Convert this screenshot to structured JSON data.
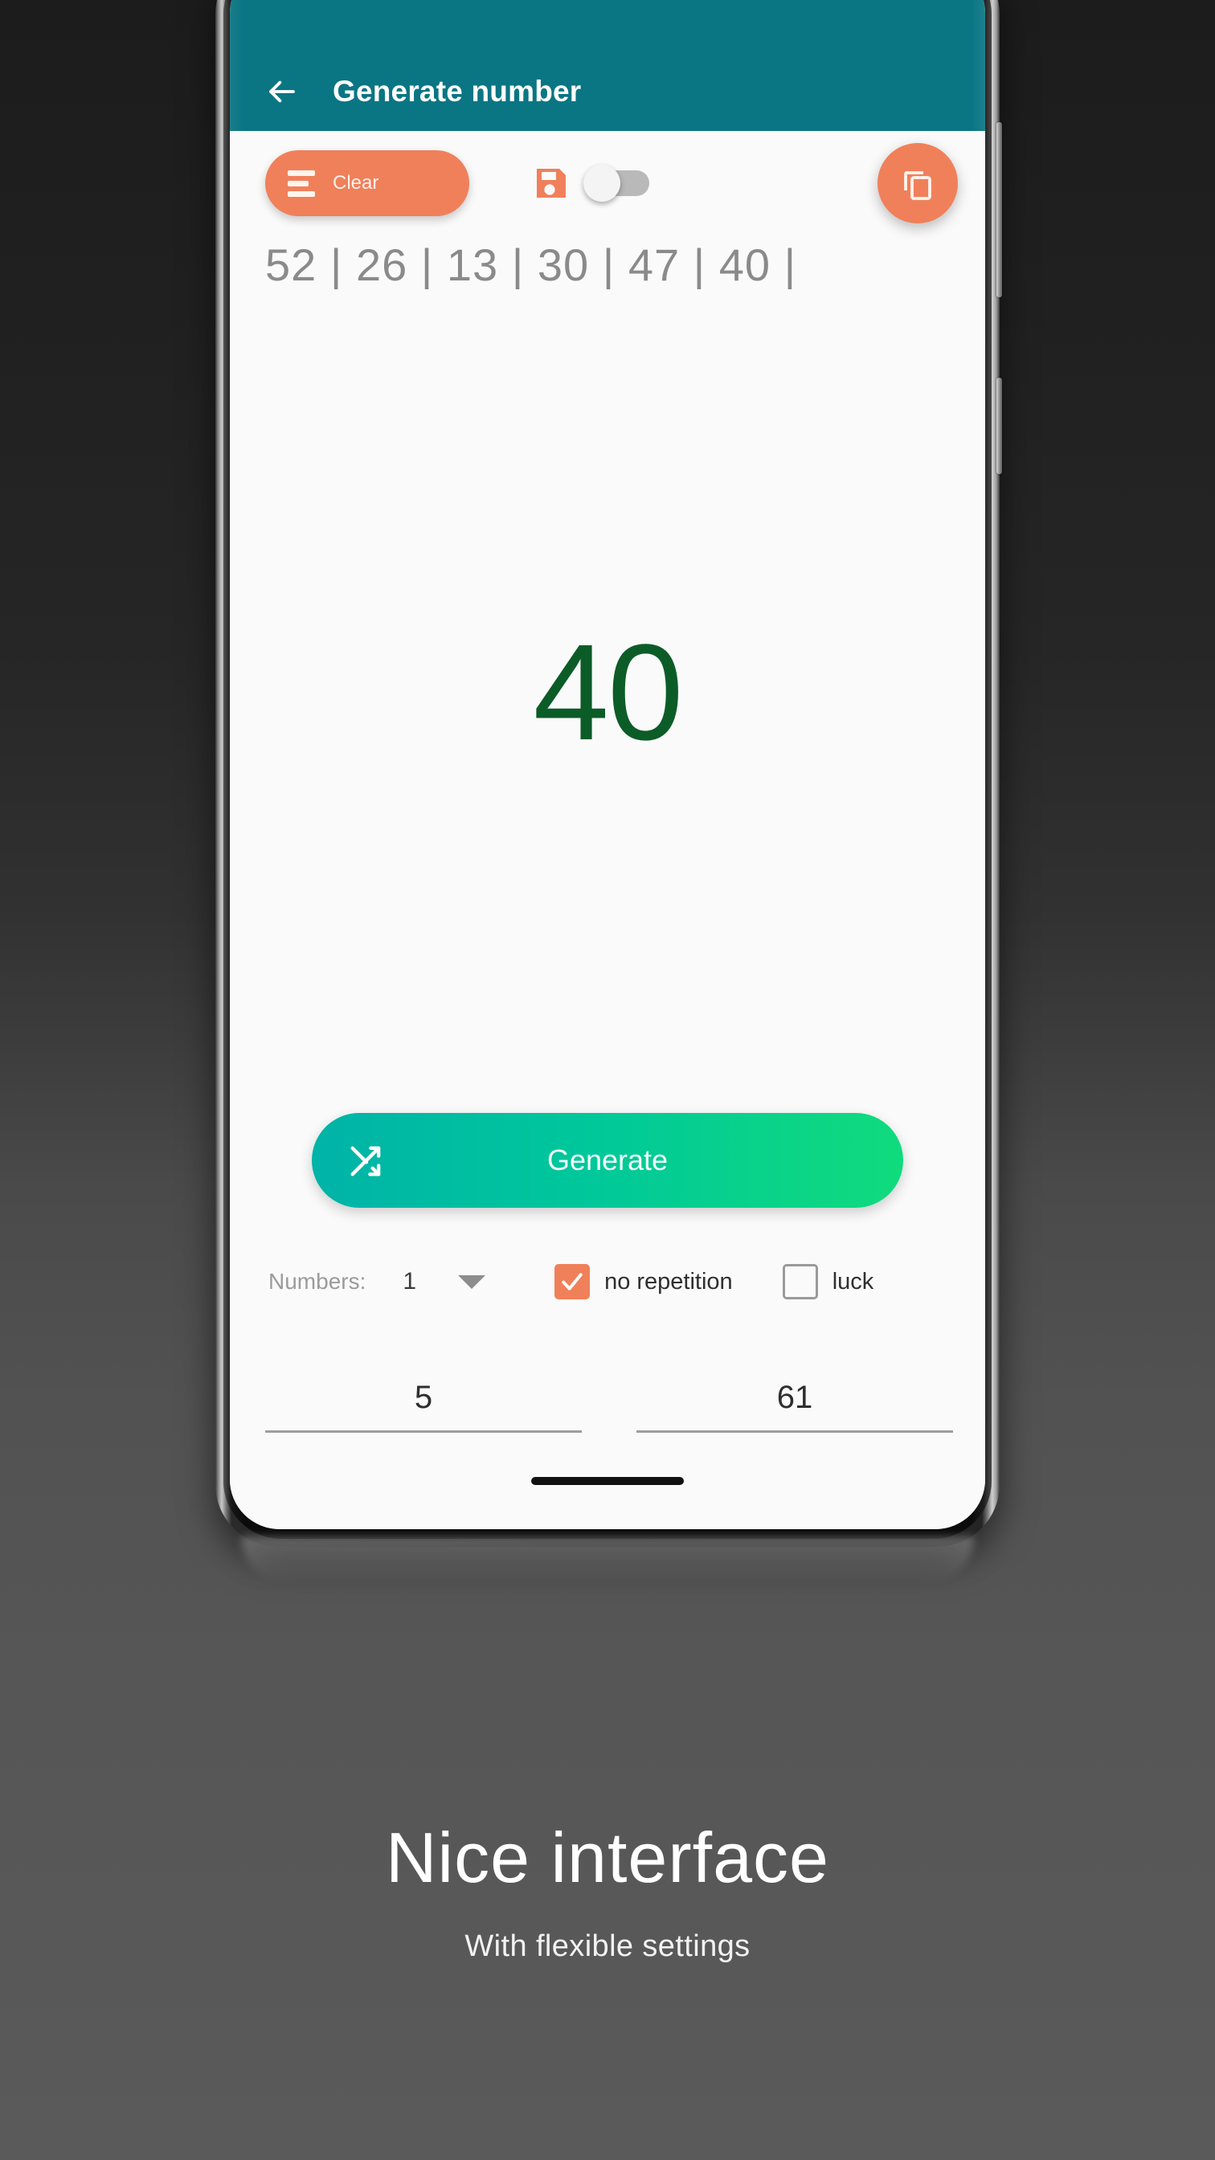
{
  "app": {
    "header": {
      "back_icon": "arrow-left-icon",
      "title": "Generate number",
      "bg_color": "#0a7583"
    },
    "toolbar": {
      "clear_label": "Clear",
      "clear_icon": "lines-icon",
      "save_icon": "floppy-save-icon",
      "save_toggle_state": "off",
      "copy_icon": "copy-icon",
      "accent_color": "#f0805a"
    },
    "history": {
      "text": "52 | 26 | 13 | 30 | 47 | 40 |",
      "values": [
        52,
        26,
        13,
        30,
        47,
        40
      ]
    },
    "result": {
      "value": "40",
      "color": "#0c5c28"
    },
    "generate": {
      "label": "Generate",
      "icon": "shuffle-icon",
      "gradient_from": "#00b3a8",
      "gradient_to": "#10db7d"
    },
    "settings": {
      "numbers_label": "Numbers:",
      "numbers_value": "1",
      "dropdown_icon": "chevron-down-icon",
      "no_repetition_label": "no repetition",
      "no_repetition_checked": true,
      "luck_label": "luck",
      "luck_checked": false
    },
    "range": {
      "min_value": "5",
      "max_value": "61"
    }
  },
  "promo": {
    "title": "Nice interface",
    "subtitle": "With flexible settings"
  }
}
